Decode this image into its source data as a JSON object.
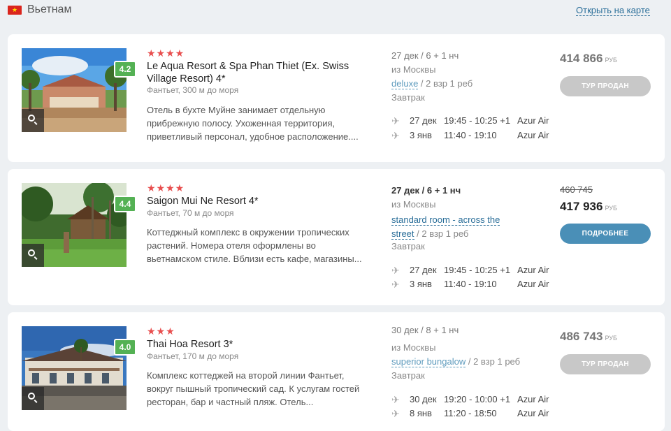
{
  "header": {
    "country": "Вьетнам",
    "map_link": "Открыть на карте"
  },
  "colors": {
    "sold": "#c8c8c8",
    "more": "#4a8fb7",
    "rating": "#54b154",
    "stars": "#e84e4e"
  },
  "currency": "РУБ",
  "hotels": [
    {
      "stars": "★★★★",
      "rating": "4.2",
      "name": "Le Aqua Resort & Spa Phan Thiet (Ex. Swiss Village Resort) 4*",
      "location": "Фантьет, 300 м до моря",
      "description": "Отель в бухте Муйне занимает отдельную прибрежную полосу. Ухоженная территория, приветливый персонал, удобное расположение....",
      "dates": "27 дек / 6 + 1 нч",
      "departure_city": "из Москвы",
      "room": "deluxe",
      "room_suffix": " / 2 взр 1 реб",
      "meal": "Завтрак",
      "flights": [
        {
          "date": "27 дек",
          "time": "19:45 - 10:25 +1",
          "airline": "Azur Air"
        },
        {
          "date": "3 янв",
          "time": "11:40 - 19:10",
          "airline": "Azur Air"
        }
      ],
      "old_price": "",
      "price": "414 866",
      "button": "ТУР ПРОДАН"
    },
    {
      "stars": "★★★★",
      "rating": "4.4",
      "name": "Saigon Mui Ne Resort 4*",
      "location": "Фантьет, 70 м до моря",
      "description": "Коттеджный комплекс в окружении тропических растений. Номера отеля оформлены во вьетнамском стиле. Вблизи есть кафе, магазины...",
      "dates": "27 дек / 6 + 1 нч",
      "departure_city": "из Москвы",
      "room": "standard room - across the street",
      "room_suffix": " / 2 взр 1 реб",
      "meal": "Завтрак",
      "flights": [
        {
          "date": "27 дек",
          "time": "19:45 - 10:25 +1",
          "airline": "Azur Air"
        },
        {
          "date": "3 янв",
          "time": "11:40 - 19:10",
          "airline": "Azur Air"
        }
      ],
      "old_price": "460 745",
      "price": "417 936",
      "button": "ПОДРОБНЕЕ"
    },
    {
      "stars": "★★★",
      "rating": "4.0",
      "name": "Thai Hoa Resort 3*",
      "location": "Фантьет, 170 м до моря",
      "description": "Комплекс коттеджей на второй линии Фантьет, вокруг пышный тропический сад. К услугам гостей ресторан, бар и частный пляж. Отель...",
      "dates": "30 дек / 8 + 1 нч",
      "departure_city": "из Москвы",
      "room": "superior bungalow",
      "room_suffix": " / 2 взр 1 реб",
      "meal": "Завтрак",
      "flights": [
        {
          "date": "30 дек",
          "time": "19:20 - 10:00 +1",
          "airline": "Azur Air"
        },
        {
          "date": "8 янв",
          "time": "11:20 - 18:50",
          "airline": "Azur Air"
        }
      ],
      "old_price": "",
      "price": "486 743",
      "button": "ТУР ПРОДАН"
    }
  ]
}
